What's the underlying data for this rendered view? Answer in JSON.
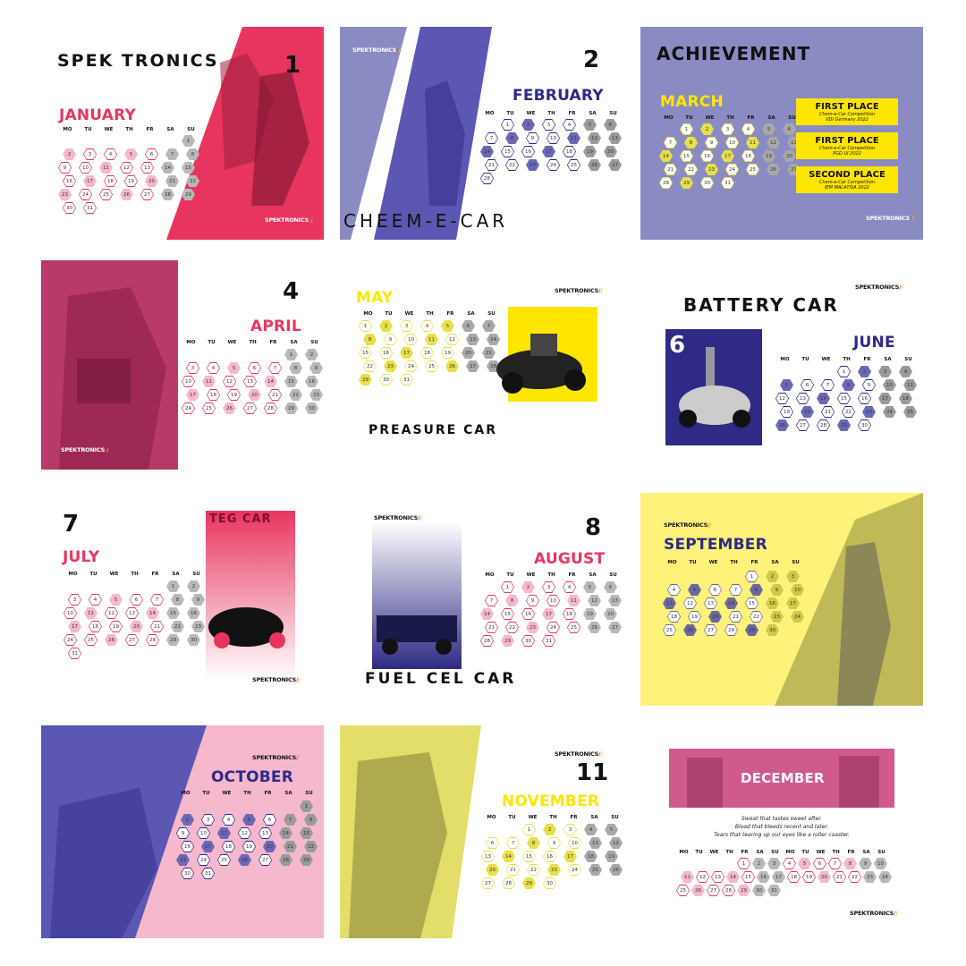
{
  "brand": "SPEKTRONICS",
  "colors": {
    "pink": "#e8355f",
    "navy": "#2e2a85",
    "indigo": "#8b8bc4",
    "yellow": "#ffe600",
    "lightpink": "#f6b8cc",
    "paleyellow": "#fff27a"
  },
  "dow": [
    "MO",
    "TU",
    "WE",
    "TH",
    "FR",
    "SA",
    "SU"
  ],
  "months": [
    {
      "key": "jan",
      "name": "JANUARY",
      "num": "1",
      "title": "SPEK TRONICS"
    },
    {
      "key": "feb",
      "name": "FEBRUARY",
      "num": "2",
      "caption": "CHEEM-E-CAR"
    },
    {
      "key": "mar",
      "name": "MARCH",
      "num": "",
      "heading": "ACHIEVEMENT"
    },
    {
      "key": "apr",
      "name": "APRIL",
      "num": "4"
    },
    {
      "key": "may",
      "name": "MAY",
      "num": "",
      "caption": "PREASURE CAR"
    },
    {
      "key": "jun",
      "name": "JUNE",
      "num": "6",
      "heading": "BATTERY CAR"
    },
    {
      "key": "jul",
      "name": "JULY",
      "num": "7",
      "heading": "TEG CAR"
    },
    {
      "key": "aug",
      "name": "AUGUST",
      "num": "8",
      "caption": "FUEL CEL CAR"
    },
    {
      "key": "sep",
      "name": "SEPTEMBER",
      "num": ""
    },
    {
      "key": "oct",
      "name": "OCTOBER",
      "num": ""
    },
    {
      "key": "nov",
      "name": "NOVEMBER",
      "num": "11"
    },
    {
      "key": "dec",
      "name": "DECEMBER",
      "num": ""
    }
  ],
  "achievements": [
    {
      "title": "FIRST PLACE",
      "line1": "Chem-e-Car Competition",
      "line2": "VDI Germany 2022"
    },
    {
      "title": "FIRST PLACE",
      "line1": "Chem-e-Car Competition",
      "line2": "PGD UI 2022"
    },
    {
      "title": "SECOND PLACE",
      "line1": "Chem-e-Car Competition",
      "line2": "IEM MALAYSIA 2022"
    }
  ],
  "december_quote": [
    "Sweat that tastes sweet after.",
    "Blood that bleeds recent and later.",
    "Tears that tearing up our eyes like a roller coaster."
  ]
}
